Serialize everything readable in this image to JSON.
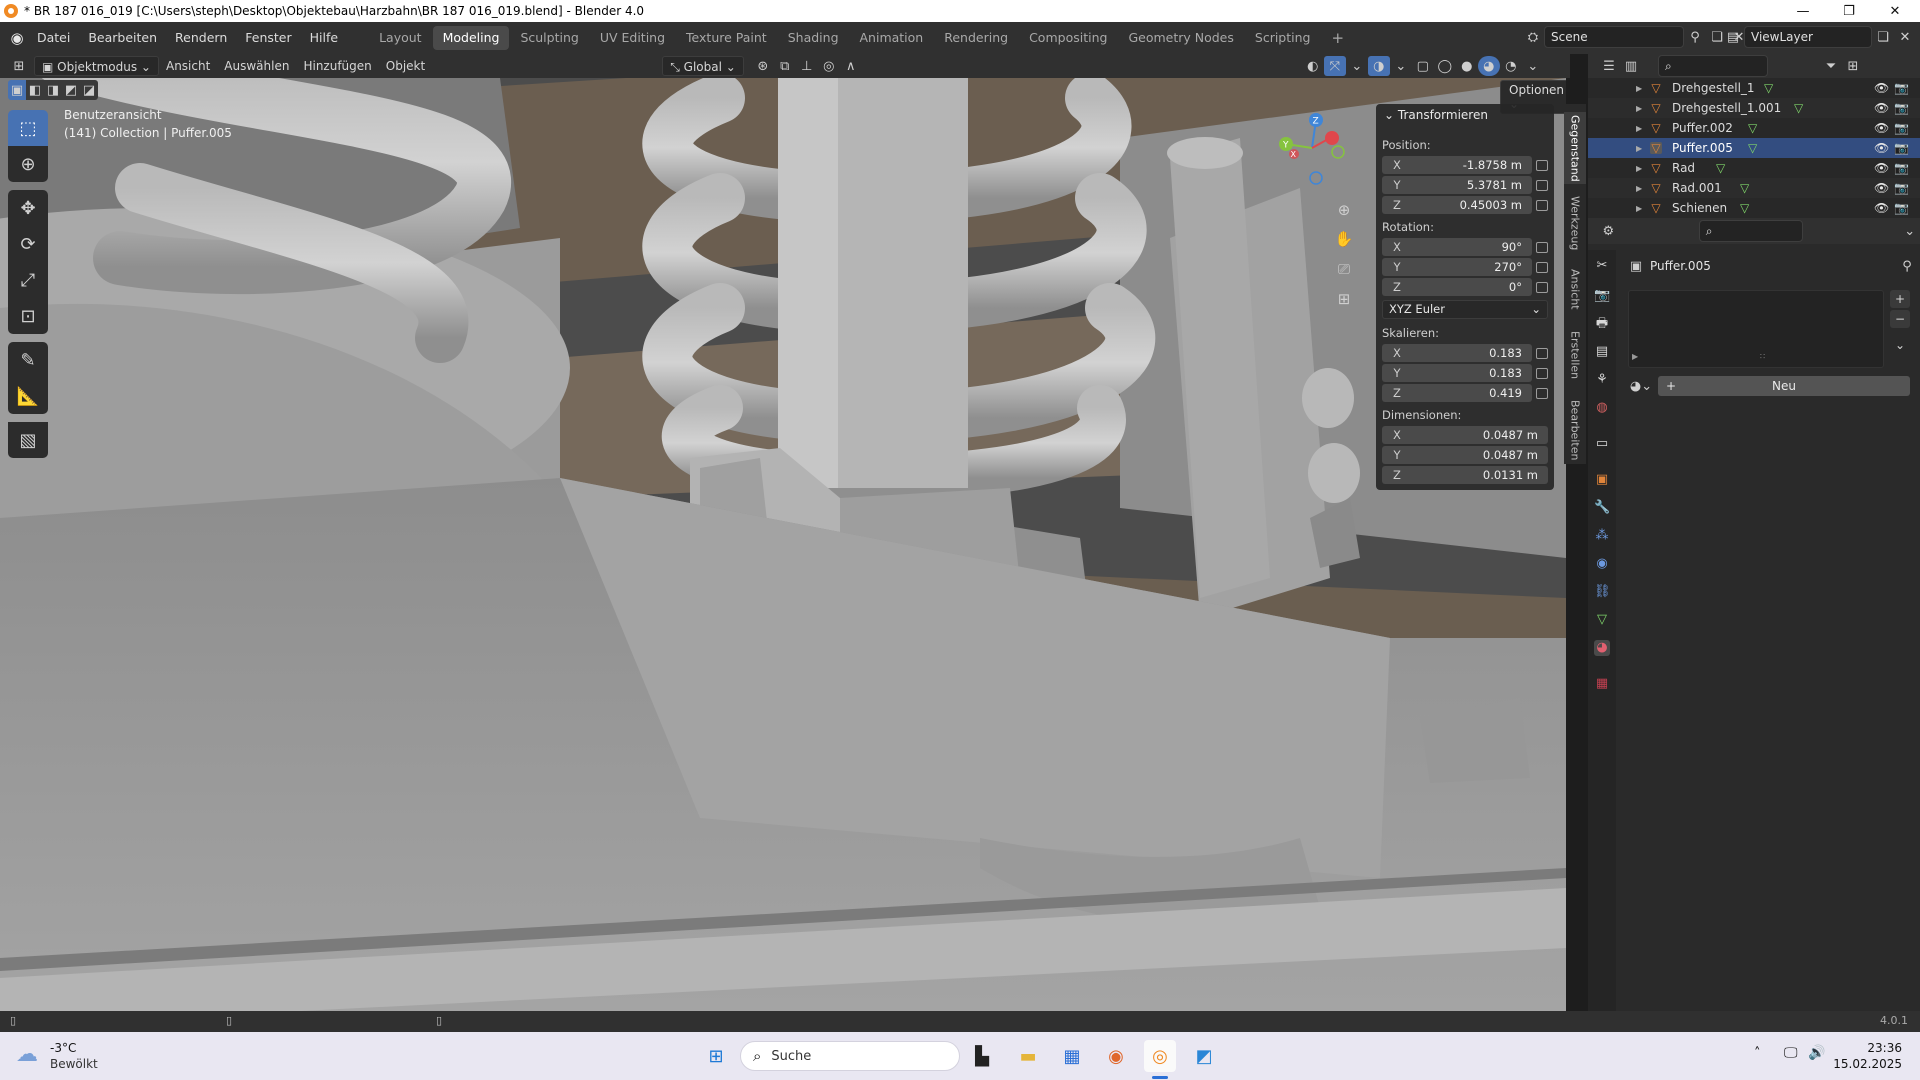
{
  "window": {
    "title": "* BR 187 016_019 [C:\\Users\\steph\\Desktop\\Objektebau\\Harzbahn\\BR 187 016_019.blend] - Blender 4.0",
    "minimize": "—",
    "maximize": "❐",
    "close": "✕"
  },
  "menu": [
    "Datei",
    "Bearbeiten",
    "Rendern",
    "Fenster",
    "Hilfe"
  ],
  "workspaces": {
    "tabs": [
      "Layout",
      "Modeling",
      "Sculpting",
      "UV Editing",
      "Texture Paint",
      "Shading",
      "Animation",
      "Rendering",
      "Compositing",
      "Geometry Nodes",
      "Scripting"
    ],
    "active": "Modeling",
    "add": "+"
  },
  "scene": {
    "name": "Scene",
    "view_layer": "ViewLayer"
  },
  "viewport_header": {
    "mode": "Objektmodus",
    "menus": [
      "Ansicht",
      "Auswählen",
      "Hinzufügen",
      "Objekt"
    ],
    "orientation": "Global",
    "options": "Optionen"
  },
  "viewport": {
    "view_name": "Benutzeransicht",
    "collection_info": "(141) Collection | Puffer.005",
    "gizmo_axes": {
      "x": "X",
      "y": "Y",
      "z": "Z"
    }
  },
  "transform_panel": {
    "title": "Transformieren",
    "position_label": "Position:",
    "position": {
      "x": "-1.8758 m",
      "y": "5.3781 m",
      "z": "0.45003 m"
    },
    "rotation_label": "Rotation:",
    "rotation": {
      "x": "90°",
      "y": "270°",
      "z": "0°"
    },
    "rotation_mode": "XYZ Euler",
    "scale_label": "Skalieren:",
    "scale": {
      "x": "0.183",
      "y": "0.183",
      "z": "0.419"
    },
    "dimensions_label": "Dimensionen:",
    "dimensions": {
      "x": "0.0487 m",
      "y": "0.0487 m",
      "z": "0.0131 m"
    },
    "axis": {
      "x": "X",
      "y": "Y",
      "z": "Z"
    }
  },
  "side_tabs": [
    "Gegenstand",
    "Werkzeug",
    "Ansicht",
    "Erstellen",
    "Bearbeiten"
  ],
  "outliner": {
    "items": [
      "Drehgestell_1",
      "Drehgestell_1.001",
      "Puffer.002",
      "Puffer.005",
      "Rad",
      "Rad.001",
      "Schienen"
    ],
    "selected": "Puffer.005"
  },
  "properties": {
    "object_name": "Puffer.005",
    "new_button": "Neu"
  },
  "statusbar": {
    "version": "4.0.1"
  },
  "taskbar": {
    "weather_temp": "-3°C",
    "weather_desc": "Bewölkt",
    "search": "Suche",
    "time": "23:36",
    "date": "15.02.2025"
  },
  "colors": {
    "accent": "#4772b3",
    "object_orange": "#e0843a",
    "mesh_green": "#7fd46a",
    "gizmo_x": "#e0474c",
    "gizmo_y": "#86c33f",
    "gizmo_z": "#3f86d8"
  }
}
